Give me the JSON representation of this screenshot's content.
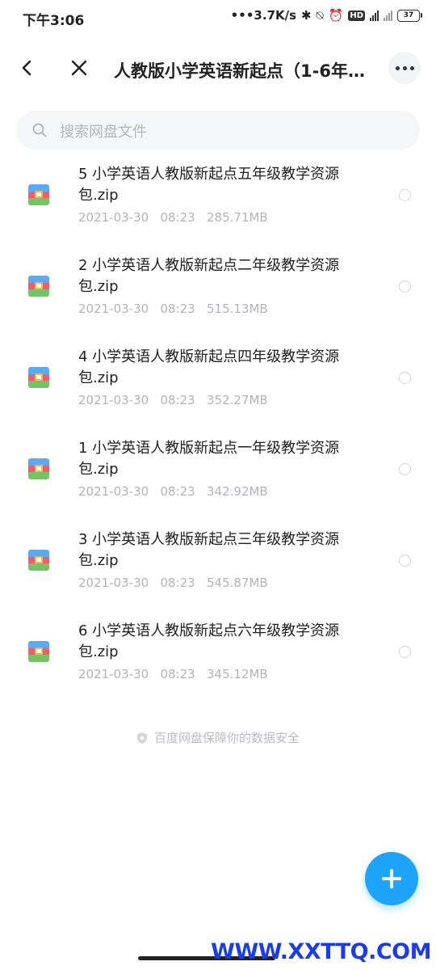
{
  "status_bar": {
    "time": "下午3:06",
    "network_speed": "•••3.7K/s",
    "battery": "37"
  },
  "header": {
    "title": "人教版小学英语新起点（1-6年…"
  },
  "search": {
    "placeholder": "搜索网盘文件"
  },
  "files": [
    {
      "name": "5 小学英语人教版新起点五年级教学资源包.zip",
      "meta": "2021-03-30   08:23   285.71MB"
    },
    {
      "name": "2 小学英语人教版新起点二年级教学资源包.zip",
      "meta": "2021-03-30   08:23   515.13MB"
    },
    {
      "name": "4 小学英语人教版新起点四年级教学资源包.zip",
      "meta": "2021-03-30   08:23   352.27MB"
    },
    {
      "name": "1 小学英语人教版新起点一年级教学资源包.zip",
      "meta": "2021-03-30   08:23   342.92MB"
    },
    {
      "name": "3 小学英语人教版新起点三年级教学资源包.zip",
      "meta": "2021-03-30   08:23   545.87MB"
    },
    {
      "name": "6 小学英语人教版新起点六年级教学资源包.zip",
      "meta": "2021-03-30   08:23   345.12MB"
    }
  ],
  "footer": {
    "safety_text": "百度网盘保障你的数据安全"
  },
  "watermark": "WWW.XXTTQ.COM",
  "colors": {
    "accent": "#1ea5fb",
    "watermark": "#1a3cf0"
  }
}
